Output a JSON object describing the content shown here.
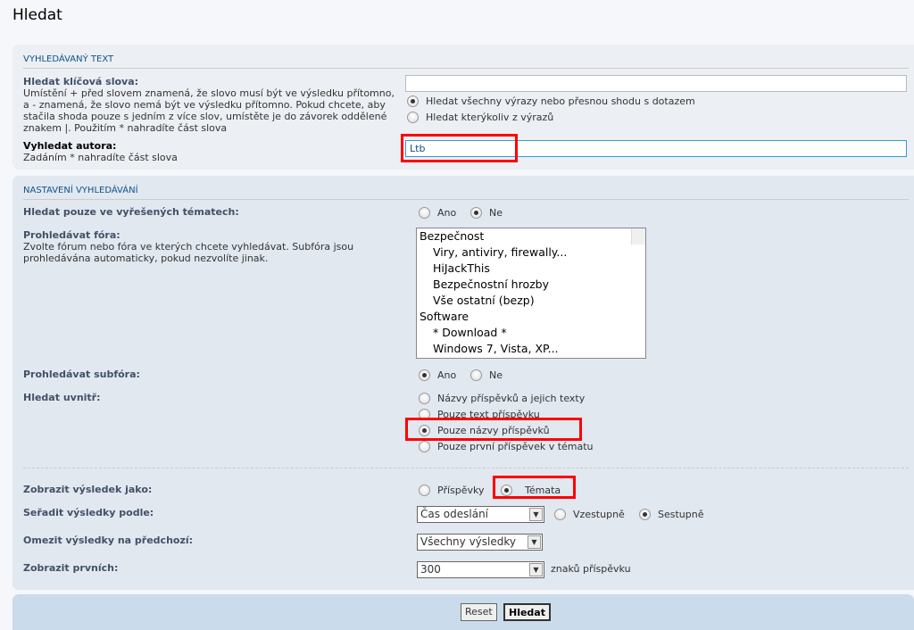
{
  "title": "Hledat",
  "search_text": {
    "legend": "VYHLEDÁVANÝ TEXT",
    "keywords_label": "Hledat klíčová slova:",
    "keywords_help": "Umístění + před slovem znamená, že slovo musí být ve výsledku přítomno, a - znamená, že slovo nemá být ve výsledku přítomno. Pokud chcete, aby stačila shoda pouze s jedním z více slov, umístěte je do závorek oddělené znakem |. Použitím * nahradíte část slova",
    "keywords_value": "",
    "terms_all": "Hledat všechny výrazy nebo přesnou shodu s dotazem",
    "terms_any": "Hledat kterýkoliv z výrazů",
    "author_label": "Vyhledat autora:",
    "author_help": "Zadáním * nahradíte část slova",
    "author_value": "Ltb"
  },
  "options": {
    "legend": "NASTAVENÍ VYHLEDÁVÁNÍ",
    "solved_label": "Hledat pouze ve vyřešených tématech:",
    "yes": "Ano",
    "no": "Ne",
    "forums_label": "Prohledávat fóra:",
    "forums_help": "Zvolte fórum nebo fóra ve kterých chcete vyhledávat. Subfóra jsou prohledávána automaticky, pokud nezvolíte jinak.",
    "forums": [
      "Bezpečnost",
      "Viry, antiviry, firewally...",
      "HiJackThis",
      "Bezpečnostní hrozby",
      "Vše ostatní (bezp)",
      "Software",
      "* Download *",
      "Windows 7, Vista, XP..."
    ],
    "subforums_label": "Prohledávat subfóra:",
    "within_label": "Hledat uvnitř:",
    "within": [
      "Názvy příspěvků a jejich texty",
      "Pouze text příspěvku",
      "Pouze názvy příspěvků",
      "Pouze první příspěvek v tématu"
    ],
    "display_label": "Zobrazit výsledek jako:",
    "display_posts": "Příspěvky",
    "display_topics": "Témata",
    "sort_label": "Seřadit výsledky podle:",
    "sort_value": "Čas odeslání",
    "asc": "Vzestupně",
    "desc": "Sestupně",
    "limit_label": "Omezit výsledky na předchozí:",
    "limit_value": "Všechny výsledky",
    "chars_label": "Zobrazit prvních:",
    "chars_value": "300",
    "chars_suffix": "znaků příspěvku"
  },
  "buttons": {
    "reset": "Reset",
    "search": "Hledat"
  }
}
